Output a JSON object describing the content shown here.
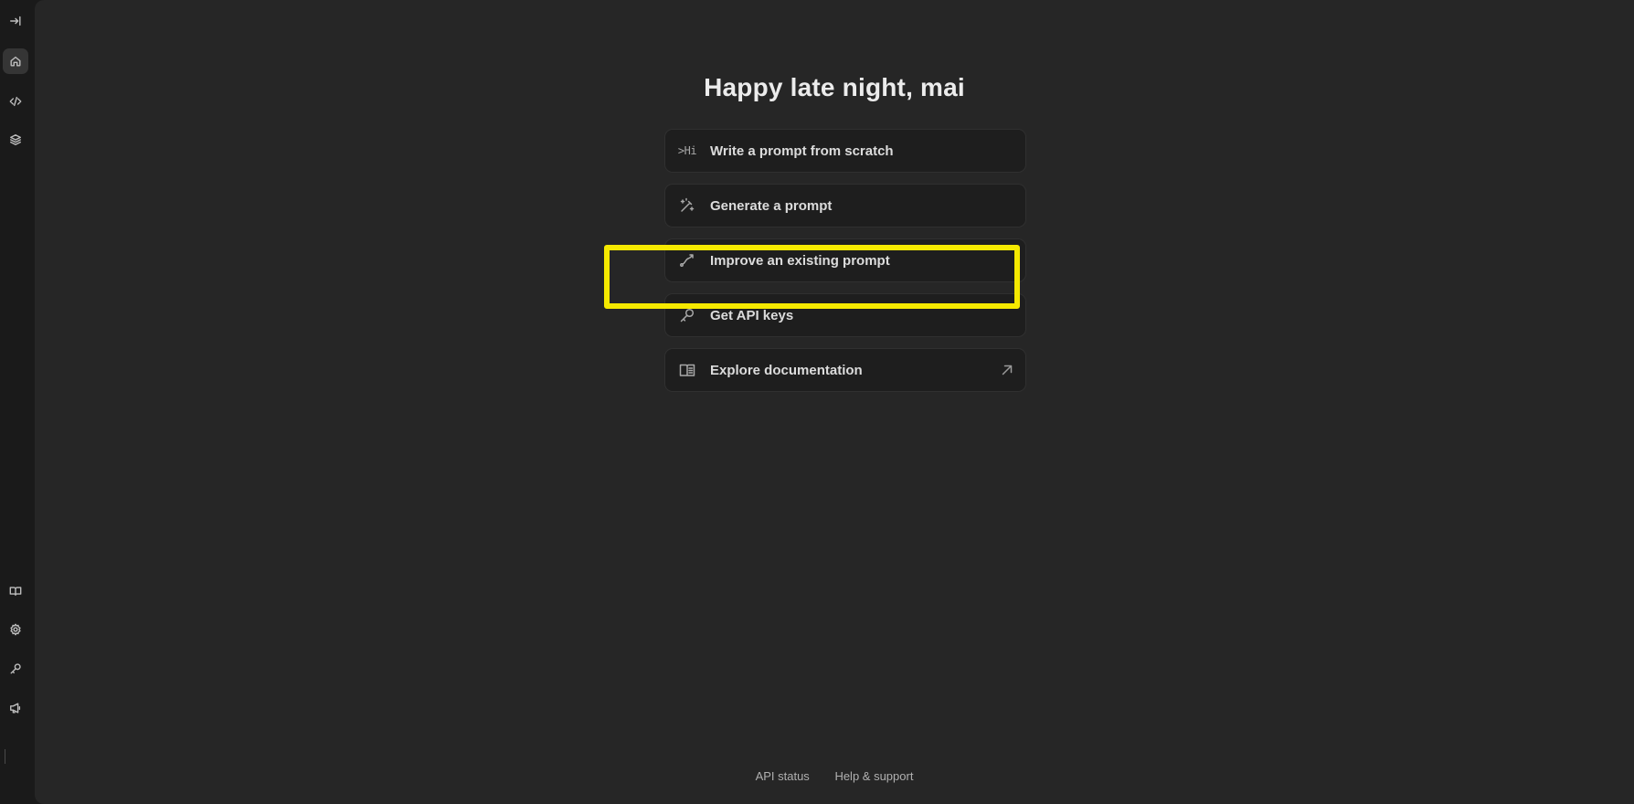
{
  "sidebar": {
    "top_items": [
      {
        "name": "collapse-sidebar",
        "icon": "arrow-right-to-line-icon"
      },
      {
        "name": "home",
        "icon": "home-icon",
        "active": true
      },
      {
        "name": "code",
        "icon": "code-icon"
      },
      {
        "name": "layers",
        "icon": "layers-icon"
      }
    ],
    "bottom_items": [
      {
        "name": "documentation",
        "icon": "book-icon"
      },
      {
        "name": "settings",
        "icon": "gear-icon"
      },
      {
        "name": "api-keys",
        "icon": "key-icon"
      },
      {
        "name": "feedback",
        "icon": "megaphone-icon"
      }
    ]
  },
  "main": {
    "greeting": "Happy late night, mai",
    "cards": [
      {
        "label": "Write a prompt from scratch",
        "icon": "terminal-hi-icon",
        "glyph": ">Hi"
      },
      {
        "label": "Generate a prompt",
        "icon": "magic-wand-icon"
      },
      {
        "label": "Improve an existing prompt",
        "icon": "trend-arrow-icon"
      },
      {
        "label": "Get API keys",
        "icon": "key-icon",
        "highlighted": true
      },
      {
        "label": "Explore documentation",
        "icon": "book-open-icon",
        "external": true
      }
    ]
  },
  "footer": {
    "api_status": "API status",
    "help_support": "Help & support"
  },
  "colors": {
    "background": "#262626",
    "sidebar": "#1a1a1a",
    "card": "#1e1e1e",
    "highlight": "#f5e900",
    "text": "#dcdcdc"
  }
}
